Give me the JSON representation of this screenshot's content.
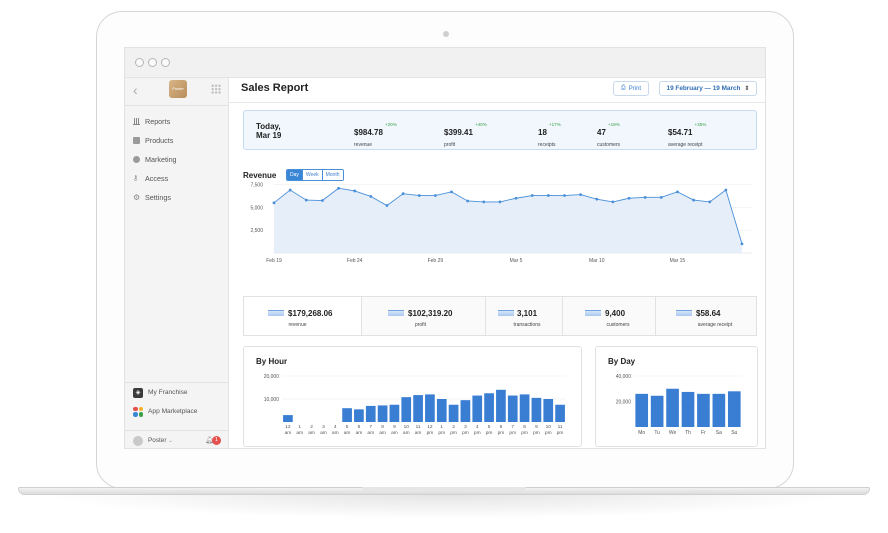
{
  "app": {
    "title": "Sales Report",
    "logo_text": "Poster"
  },
  "toolbar": {
    "print_label": "Print",
    "date_range": "19 February — 19 March"
  },
  "sidebar": {
    "items": [
      {
        "label": "Reports",
        "icon": "bar-chart-icon"
      },
      {
        "label": "Products",
        "icon": "document-icon"
      },
      {
        "label": "Marketing",
        "icon": "pie-icon"
      },
      {
        "label": "Access",
        "icon": "key-icon"
      },
      {
        "label": "Settings",
        "icon": "gear-icon"
      }
    ],
    "bottom": [
      {
        "label": "My Franchise",
        "icon": "franchise-icon"
      },
      {
        "label": "App Marketplace",
        "icon": "marketplace-icon"
      }
    ],
    "user": {
      "name": "Poster",
      "notifications": "1"
    }
  },
  "summary": {
    "period_line1": "Today,",
    "period_line2": "Mar 19",
    "stats": [
      {
        "value": "$984.78",
        "delta": "+20%",
        "label": "revenue"
      },
      {
        "value": "$399.41",
        "delta": "+40%",
        "label": "profit"
      },
      {
        "value": "18",
        "delta": "+17%",
        "label": "receipts"
      },
      {
        "value": "47",
        "delta": "+19%",
        "label": "customers"
      },
      {
        "value": "$54.71",
        "delta": "+35%",
        "label": "average receipt"
      }
    ]
  },
  "revenue": {
    "title": "Revenue",
    "segments": [
      "Day",
      "Week",
      "Month"
    ],
    "active_segment": "Day"
  },
  "totals": [
    {
      "value": "$179,268.06",
      "label": "revenue"
    },
    {
      "value": "$102,319.20",
      "label": "profit"
    },
    {
      "value": "3,101",
      "label": "transactions"
    },
    {
      "value": "9,400",
      "label": "customers"
    },
    {
      "value": "$58.64",
      "label": "average receipt"
    }
  ],
  "colors": {
    "accent": "#3a86d6",
    "bar": "#3a7ed4",
    "area": "#e6eff9",
    "line": "#4a8fd9",
    "positive": "#3aa04a"
  },
  "chart_data": [
    {
      "type": "area",
      "title": "Revenue",
      "x": [
        "Feb 19",
        "Feb 20",
        "Feb 21",
        "Feb 22",
        "Feb 23",
        "Feb 24",
        "Feb 25",
        "Feb 26",
        "Feb 27",
        "Feb 28",
        "Feb 29",
        "Mar 1",
        "Mar 2",
        "Mar 3",
        "Mar 4",
        "Mar 5",
        "Mar 6",
        "Mar 7",
        "Mar 8",
        "Mar 9",
        "Mar 10",
        "Mar 11",
        "Mar 12",
        "Mar 13",
        "Mar 14",
        "Mar 15",
        "Mar 16",
        "Mar 17",
        "Mar 18",
        "Mar 19"
      ],
      "values": [
        5500,
        6900,
        5800,
        5750,
        7100,
        6800,
        6200,
        5200,
        6500,
        6300,
        6300,
        6700,
        5700,
        5600,
        5600,
        6000,
        6300,
        6300,
        6300,
        6400,
        5900,
        5600,
        6000,
        6100,
        6100,
        6700,
        5800,
        5600,
        6900,
        1000
      ],
      "x_ticks": [
        "Feb 19",
        "Feb 24",
        "Feb 29",
        "Mar 5",
        "Mar 10",
        "Mar 15"
      ],
      "y_ticks": [
        "7,500",
        "5,000",
        "2,500"
      ],
      "ylim": [
        0,
        8000
      ],
      "grid": true
    },
    {
      "type": "bar",
      "title": "By Hour",
      "categories": [
        "12 am",
        "1 am",
        "2 am",
        "3 am",
        "4 am",
        "5 am",
        "6 am",
        "7 am",
        "8 am",
        "9 am",
        "10 am",
        "11 am",
        "12 pm",
        "1 pm",
        "2 pm",
        "3 pm",
        "4 pm",
        "5 pm",
        "6 pm",
        "7 pm",
        "8 pm",
        "9 pm",
        "10 pm",
        "11 pm"
      ],
      "values": [
        3000,
        0,
        0,
        0,
        0,
        6000,
        5500,
        7000,
        7200,
        7500,
        10800,
        11700,
        12000,
        10000,
        7500,
        9500,
        11500,
        12500,
        14000,
        11500,
        12000,
        10500,
        10000,
        7500
      ],
      "y_ticks": [
        "20,000",
        "10,000"
      ],
      "ylim": [
        0,
        20000
      ]
    },
    {
      "type": "bar",
      "title": "By Day",
      "categories": [
        "Mo",
        "Tu",
        "We",
        "Th",
        "Fr",
        "Sa",
        "Su"
      ],
      "values": [
        26000,
        24500,
        30000,
        27500,
        26000,
        26000,
        28000
      ],
      "y_ticks": [
        "40,000",
        "20,000"
      ],
      "ylim": [
        0,
        40000
      ]
    }
  ]
}
